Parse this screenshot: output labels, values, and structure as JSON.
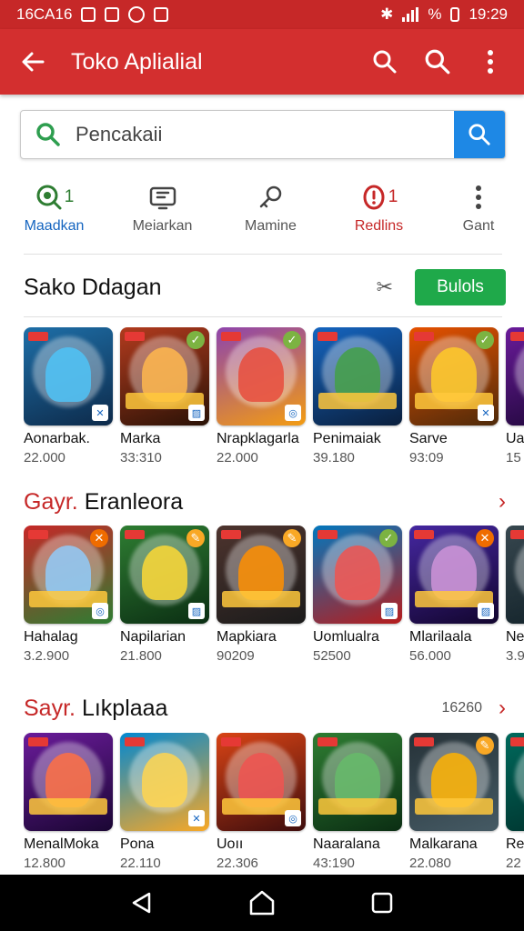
{
  "status_bar": {
    "time_left": "16CA16",
    "percent": "%",
    "time_right": "19:29"
  },
  "app_bar": {
    "title": "Toko Aplialial",
    "back_icon": "arrow-left-icon",
    "actions": [
      "search-icon",
      "search-icon",
      "more-vert-icon"
    ]
  },
  "search": {
    "placeholder": "Pencakaii",
    "value": ""
  },
  "categories": [
    {
      "label": "Maadkan",
      "count": "1",
      "icon": "search-badge-icon",
      "style": "green"
    },
    {
      "label": "Meiarkan",
      "count": "",
      "icon": "tv-icon",
      "style": "plain"
    },
    {
      "label": "Mamine",
      "count": "",
      "icon": "key-icon",
      "style": "plain"
    },
    {
      "label": "Redlins",
      "count": "1",
      "icon": "alert-icon",
      "style": "red"
    },
    {
      "label": "Gant",
      "count": "",
      "icon": "more-vert-icon",
      "style": "plain"
    }
  ],
  "section1": {
    "title": "Sako Ddagan",
    "button_label": "Bulols",
    "apps": [
      {
        "name": "Aonarbak.",
        "count": "22.000",
        "c1": "#1e6fa8",
        "c2": "#0d2a4a",
        "hero": "#4fc3f7",
        "badge": "",
        "corner": "✕",
        "banner": false
      },
      {
        "name": "Marka",
        "count": "33:310",
        "c1": "#b23b1e",
        "c2": "#2a1206",
        "hero": "#ffb74d",
        "badge": "✓",
        "corner": "▨",
        "banner": true
      },
      {
        "name": "Nrapklagarla",
        "count": "22.000",
        "c1": "#8e44ad",
        "c2": "#f39c12",
        "hero": "#e74c3c",
        "badge": "✓",
        "corner": "◎",
        "banner": false
      },
      {
        "name": "Penimaiak",
        "count": "39.180",
        "c1": "#1565c0",
        "c2": "#0a1f3d",
        "hero": "#43a047",
        "badge": "",
        "corner": "",
        "banner": true
      },
      {
        "name": "Sarve",
        "count": "93:09",
        "c1": "#e65100",
        "c2": "#4e2a0a",
        "hero": "#ffca28",
        "badge": "✓",
        "corner": "✕",
        "banner": true
      },
      {
        "name": "Ua",
        "count": "15",
        "c1": "#6a1b9a",
        "c2": "#1a0633",
        "hero": "#ff7043",
        "badge": "",
        "corner": "",
        "banner": false
      }
    ]
  },
  "section2": {
    "title_accent": "Gayr.",
    "title_rest": "Eranleora",
    "apps": [
      {
        "name": "Hahalag",
        "count": "3.2.900",
        "c1": "#c62828",
        "c2": "#2e7d32",
        "hero": "#90caf9",
        "badge": "✕",
        "corner": "◎",
        "banner": true
      },
      {
        "name": "Napilarian",
        "count": "21.800",
        "c1": "#2e7d32",
        "c2": "#0b2e13",
        "hero": "#fdd835",
        "badge": "✎",
        "corner": "▨",
        "banner": false
      },
      {
        "name": "Mapkiara",
        "count": "90209",
        "c1": "#4e342e",
        "c2": "#1b1b1b",
        "hero": "#ff8f00",
        "badge": "✎",
        "corner": "",
        "banner": true
      },
      {
        "name": "Uomlualra",
        "count": "52500",
        "c1": "#0277bd",
        "c2": "#b71c1c",
        "hero": "#ef5350",
        "badge": "✓",
        "corner": "▨",
        "banner": false
      },
      {
        "name": "Mlarilaala",
        "count": "56.000",
        "c1": "#4527a0",
        "c2": "#12052e",
        "hero": "#ce93d8",
        "badge": "✕",
        "corner": "▨",
        "banner": true
      },
      {
        "name": "Ne",
        "count": "3.9",
        "c1": "#37474f",
        "c2": "#102027",
        "hero": "#b0bec5",
        "badge": "",
        "corner": "",
        "banner": false
      }
    ]
  },
  "section3": {
    "title_accent": "Sayr.",
    "title_rest": "Lıkplaaa",
    "extra": "16260",
    "apps": [
      {
        "name": "MenalMoka",
        "count": "12.800",
        "c1": "#6a1b9a",
        "c2": "#1a0633",
        "hero": "#ff7043",
        "badge": "",
        "corner": "",
        "banner": true
      },
      {
        "name": "Pona",
        "count": "22.110",
        "c1": "#0288d1",
        "c2": "#f9a825",
        "hero": "#ffd54f",
        "badge": "",
        "corner": "✕",
        "banner": false
      },
      {
        "name": "Uoıı",
        "count": "22.306",
        "c1": "#d84315",
        "c2": "#3e0d0d",
        "hero": "#ef5350",
        "badge": "",
        "corner": "◎",
        "banner": true
      },
      {
        "name": "Naaralana",
        "count": "43:190",
        "c1": "#2e7d32",
        "c2": "#0b2e13",
        "hero": "#66bb6a",
        "badge": "",
        "corner": "",
        "banner": true
      },
      {
        "name": "Malkarana",
        "count": "22.080",
        "c1": "#263238",
        "c2": "#455a64",
        "hero": "#ffb300",
        "badge": "✎",
        "corner": "",
        "banner": true
      },
      {
        "name": "Re",
        "count": "22",
        "c1": "#00695c",
        "c2": "#002f2a",
        "hero": "#80cbc4",
        "badge": "",
        "corner": "",
        "banner": false
      }
    ]
  },
  "nav_bar": {
    "icons": [
      "back-triangle-icon",
      "home-circle-icon",
      "recents-square-icon"
    ]
  }
}
